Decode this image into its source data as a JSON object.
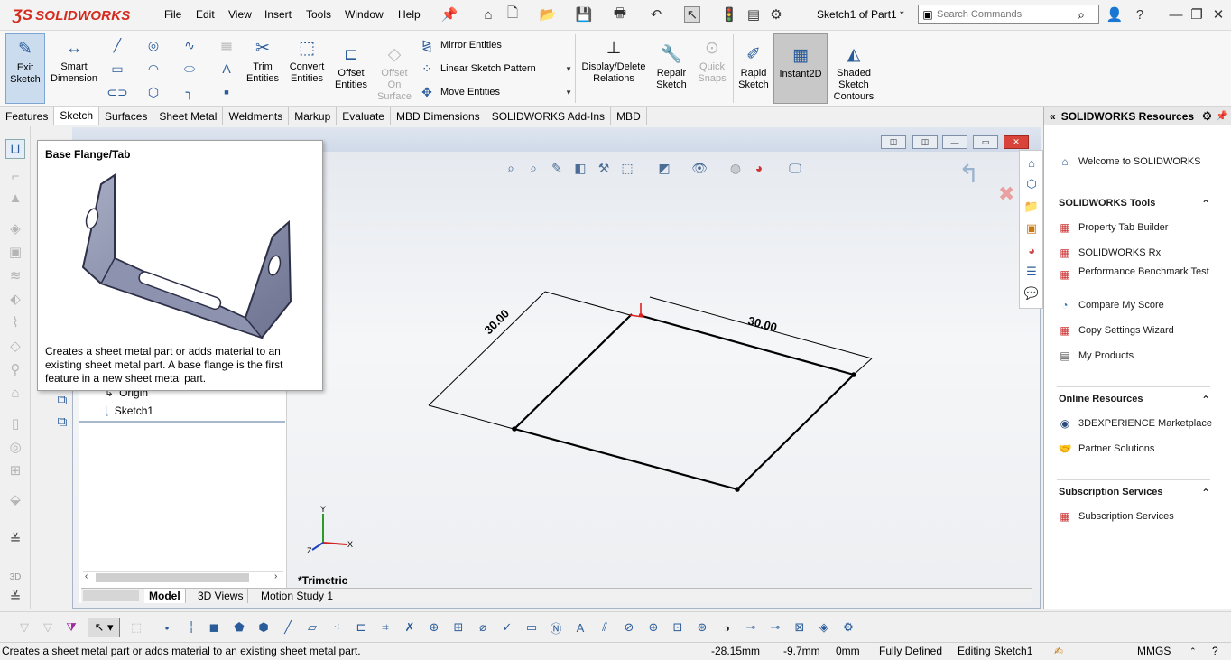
{
  "app": {
    "logo": "SOLIDWORKS",
    "doc_title": "Sketch1 of Part1 *"
  },
  "menu": [
    "File",
    "Edit",
    "View",
    "Insert",
    "Tools",
    "Window",
    "Help"
  ],
  "search": {
    "placeholder": "Search Commands"
  },
  "sketch_group": {
    "exit_sketch": [
      "Exit",
      "Sketch"
    ],
    "smart_dimension": [
      "Smart",
      "Dimension"
    ],
    "trim": [
      "Trim",
      "Entities"
    ],
    "convert": [
      "Convert",
      "Entities"
    ],
    "offset": [
      "Offset",
      "Entities"
    ],
    "offset_surface": [
      "Offset",
      "On",
      "Surface"
    ],
    "mirror": "Mirror Entities",
    "linear_pattern": "Linear Sketch Pattern",
    "move": "Move Entities",
    "display_delete": [
      "Display/Delete",
      "Relations"
    ],
    "repair": [
      "Repair",
      "Sketch"
    ],
    "quick_snaps": [
      "Quick",
      "Snaps"
    ],
    "rapid": [
      "Rapid",
      "Sketch"
    ],
    "instant2d": "Instant2D",
    "shaded": [
      "Shaded",
      "Sketch",
      "Contours"
    ]
  },
  "tabs": [
    "Features",
    "Sketch",
    "Surfaces",
    "Sheet Metal",
    "Weldments",
    "Markup",
    "Evaluate",
    "MBD Dimensions",
    "SOLIDWORKS Add-Ins",
    "MBD"
  ],
  "active_tab": "Sketch",
  "tooltip": {
    "title": "Base Flange/Tab",
    "body": "Creates a sheet metal part or adds material to an existing sheet metal part. A base flange is the first feature in a new sheet metal part."
  },
  "tree": {
    "origin": "Origin",
    "sketch1": "Sketch1"
  },
  "bottom_tabs": [
    "Model",
    "3D Views",
    "Motion Study 1"
  ],
  "view_label": "*Trimetric",
  "dimensions": {
    "left": "30.00",
    "top": "30.00"
  },
  "triad": {
    "x": "X",
    "y": "Y",
    "z": "Z"
  },
  "taskpane": {
    "title": "SOLIDWORKS Resources",
    "welcome": "Welcome to SOLIDWORKS",
    "sw_tools_title": "SOLIDWORKS Tools",
    "sw_tools": [
      "Property Tab Builder",
      "SOLIDWORKS Rx",
      "Performance Benchmark Test",
      "Compare My Score",
      "Copy Settings Wizard",
      "My Products"
    ],
    "online_title": "Online Resources",
    "online": [
      "3DEXPERIENCE Marketplace",
      "Partner Solutions"
    ],
    "subs_title": "Subscription Services",
    "subs": [
      "Subscription Services"
    ]
  },
  "status": {
    "message": "Creates a sheet metal part or adds material to an existing sheet metal part.",
    "x": "-28.15mm",
    "y": "-9.7mm",
    "z": "0mm",
    "state": "Fully Defined",
    "mode": "Editing Sketch1",
    "units": "MMGS"
  },
  "colors": {
    "brand": "#d52b1e",
    "accent": "#2a5c9a",
    "sketch_line": "#000000",
    "relation": "#e02020"
  }
}
